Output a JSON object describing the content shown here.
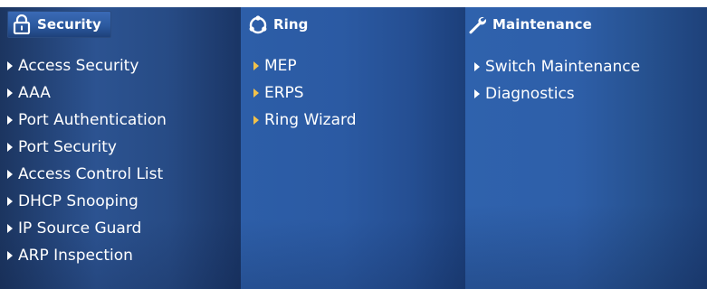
{
  "sections": {
    "security": {
      "title": "Security",
      "icon": "lock-icon",
      "items": [
        "Access Security",
        "AAA",
        "Port Authentication",
        "Port Security",
        "Access Control List",
        "DHCP Snooping",
        "IP Source Guard",
        "ARP Inspection"
      ]
    },
    "ring": {
      "title": "Ring",
      "icon": "ring-icon",
      "items": [
        "MEP",
        "ERPS",
        "Ring Wizard"
      ]
    },
    "maintenance": {
      "title": "Maintenance",
      "icon": "wrench-icon",
      "items": [
        "Switch Maintenance",
        "Diagnostics"
      ]
    }
  },
  "colors": {
    "text": "#ffffff",
    "ring_arrow": "#f1c14a",
    "panel_dark": "#1c3560",
    "panel_mid": "#2c5aa0"
  }
}
